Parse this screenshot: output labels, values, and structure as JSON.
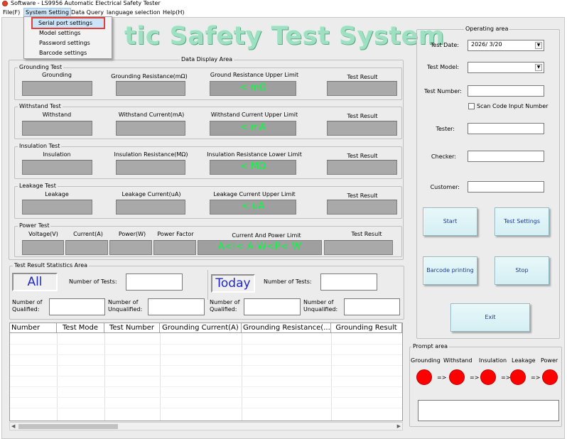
{
  "window": {
    "title": "Software - LS9956 Automatic Electrical Safety Tester"
  },
  "menu": {
    "file": "File(F)",
    "system_setting": "System Setting",
    "data_query": "Data Query",
    "language": "language selection",
    "help": "Help(H)"
  },
  "dropdown": {
    "items": [
      "Serial port settings",
      "Model settings",
      "Password settings",
      "Barcode settings"
    ],
    "highlighted": "Serial port settings"
  },
  "banner": {
    "visible_text": "tic Safety Test System"
  },
  "data_display": {
    "legend": "Data Display Area",
    "grounding": {
      "legend": "Grounding Test",
      "col1": "Grounding",
      "col2": "Grounding Resistance(mΩ)",
      "col3": "Ground Resistance Upper Limit",
      "col4": "Test Result",
      "limit": "< mΩ"
    },
    "withstand": {
      "legend": "Withstand Test",
      "col1": "Withstand",
      "col2": "Withstand Current(mA)",
      "col3": "Withstand Current Upper Limit",
      "col4": "Test Result",
      "limit": "<  mA"
    },
    "insulation": {
      "legend": "Insulation Test",
      "col1": "Insulation",
      "col2": "Insulation Resistance(MΩ)",
      "col3": "Insulation Resistance Lower Limit",
      "col4": "Test Result",
      "limit": "< MΩ"
    },
    "leakage": {
      "legend": "Leakage Test",
      "col1": "Leakage",
      "col2": "Leakage Current(uA)",
      "col3": "Leakage Current Upper Limit",
      "col4": "Test Result",
      "limit": "< uA"
    },
    "power": {
      "legend": "Power Test",
      "col1": "Voltage(V)",
      "col2": "Current(A)",
      "col3": "Power(W)",
      "col4": "Power Factor",
      "col5": "Current And Power Limit",
      "col6": "Test Result",
      "limit": "A<I< A W<P< W"
    }
  },
  "stats": {
    "legend": "Test Result Statistics Area",
    "all_label": "All",
    "today_label": "Today",
    "num_tests": "Number of Tests:",
    "num_qualified": "Number of\nQualified:",
    "num_qualified_l1": "Number of",
    "num_qualified_l2": "Qualified:",
    "num_unqualified_l1": "Number of",
    "num_unqualified_l2": "Unqualified:"
  },
  "grid": {
    "columns": [
      "Number",
      "Test Mode",
      "Test Number",
      "Grounding Current(A)",
      "Grounding Resistance(...",
      "Grounding Result"
    ]
  },
  "operating": {
    "legend": "Operating area",
    "test_date_label": "Test Date:",
    "test_date_value": "2026/  3/20",
    "test_model_label": "Test Model:",
    "test_model_value": "",
    "test_number_label": "Test Number:",
    "scan_code_label": "Scan Code Input Number",
    "tester_label": "Tester:",
    "checker_label": "Checker:",
    "customer_label": "Customer:",
    "start": "Start",
    "test_settings": "Test Settings",
    "barcode_printing": "Barcode printing",
    "stop": "Stop",
    "exit": "Exit"
  },
  "prompt": {
    "legend": "Prompt area",
    "stages": [
      "Grounding",
      "Withstand",
      "Insulation",
      "Leakage",
      "Power"
    ],
    "arrow": "=>",
    "lamp_color": "#ff0000"
  }
}
